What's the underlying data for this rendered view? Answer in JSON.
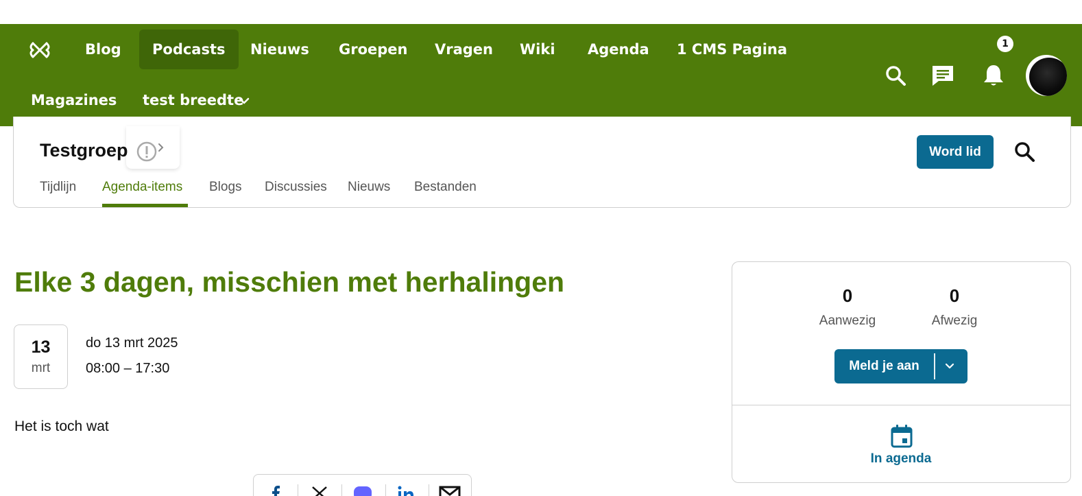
{
  "nav": {
    "items": [
      "Blog",
      "Podcasts",
      "Nieuws",
      "Groepen",
      "Vragen",
      "Wiki",
      "Agenda",
      "1 CMS Pagina"
    ],
    "row2": [
      "Magazines",
      "test breedte"
    ],
    "notification_count": "1",
    "bg_color": "#4f7c0a"
  },
  "group": {
    "title": "Testgroep",
    "join_button": "Word lid",
    "tabs": [
      "Tijdlijn",
      "Agenda-items",
      "Blogs",
      "Discussies",
      "Nieuws",
      "Bestanden"
    ],
    "active_tab": "Agenda-items"
  },
  "event": {
    "title": "Elke 3 dagen, misschien met herhalingen",
    "day": "13",
    "month": "mrt",
    "date_text": "do 13 mrt 2025",
    "time_text": "08:00 – 17:30",
    "description": "Het is toch wat"
  },
  "attendance": {
    "present_count": "0",
    "present_label": "Aanwezig",
    "absent_count": "0",
    "absent_label": "Afwezig",
    "register_button": "Meld je aan",
    "calendar_label": "In agenda",
    "accent_color": "#0b6a91"
  },
  "share": {
    "icons": [
      "facebook-icon",
      "x-icon",
      "mastodon-icon",
      "linkedin-icon",
      "email-icon"
    ]
  }
}
